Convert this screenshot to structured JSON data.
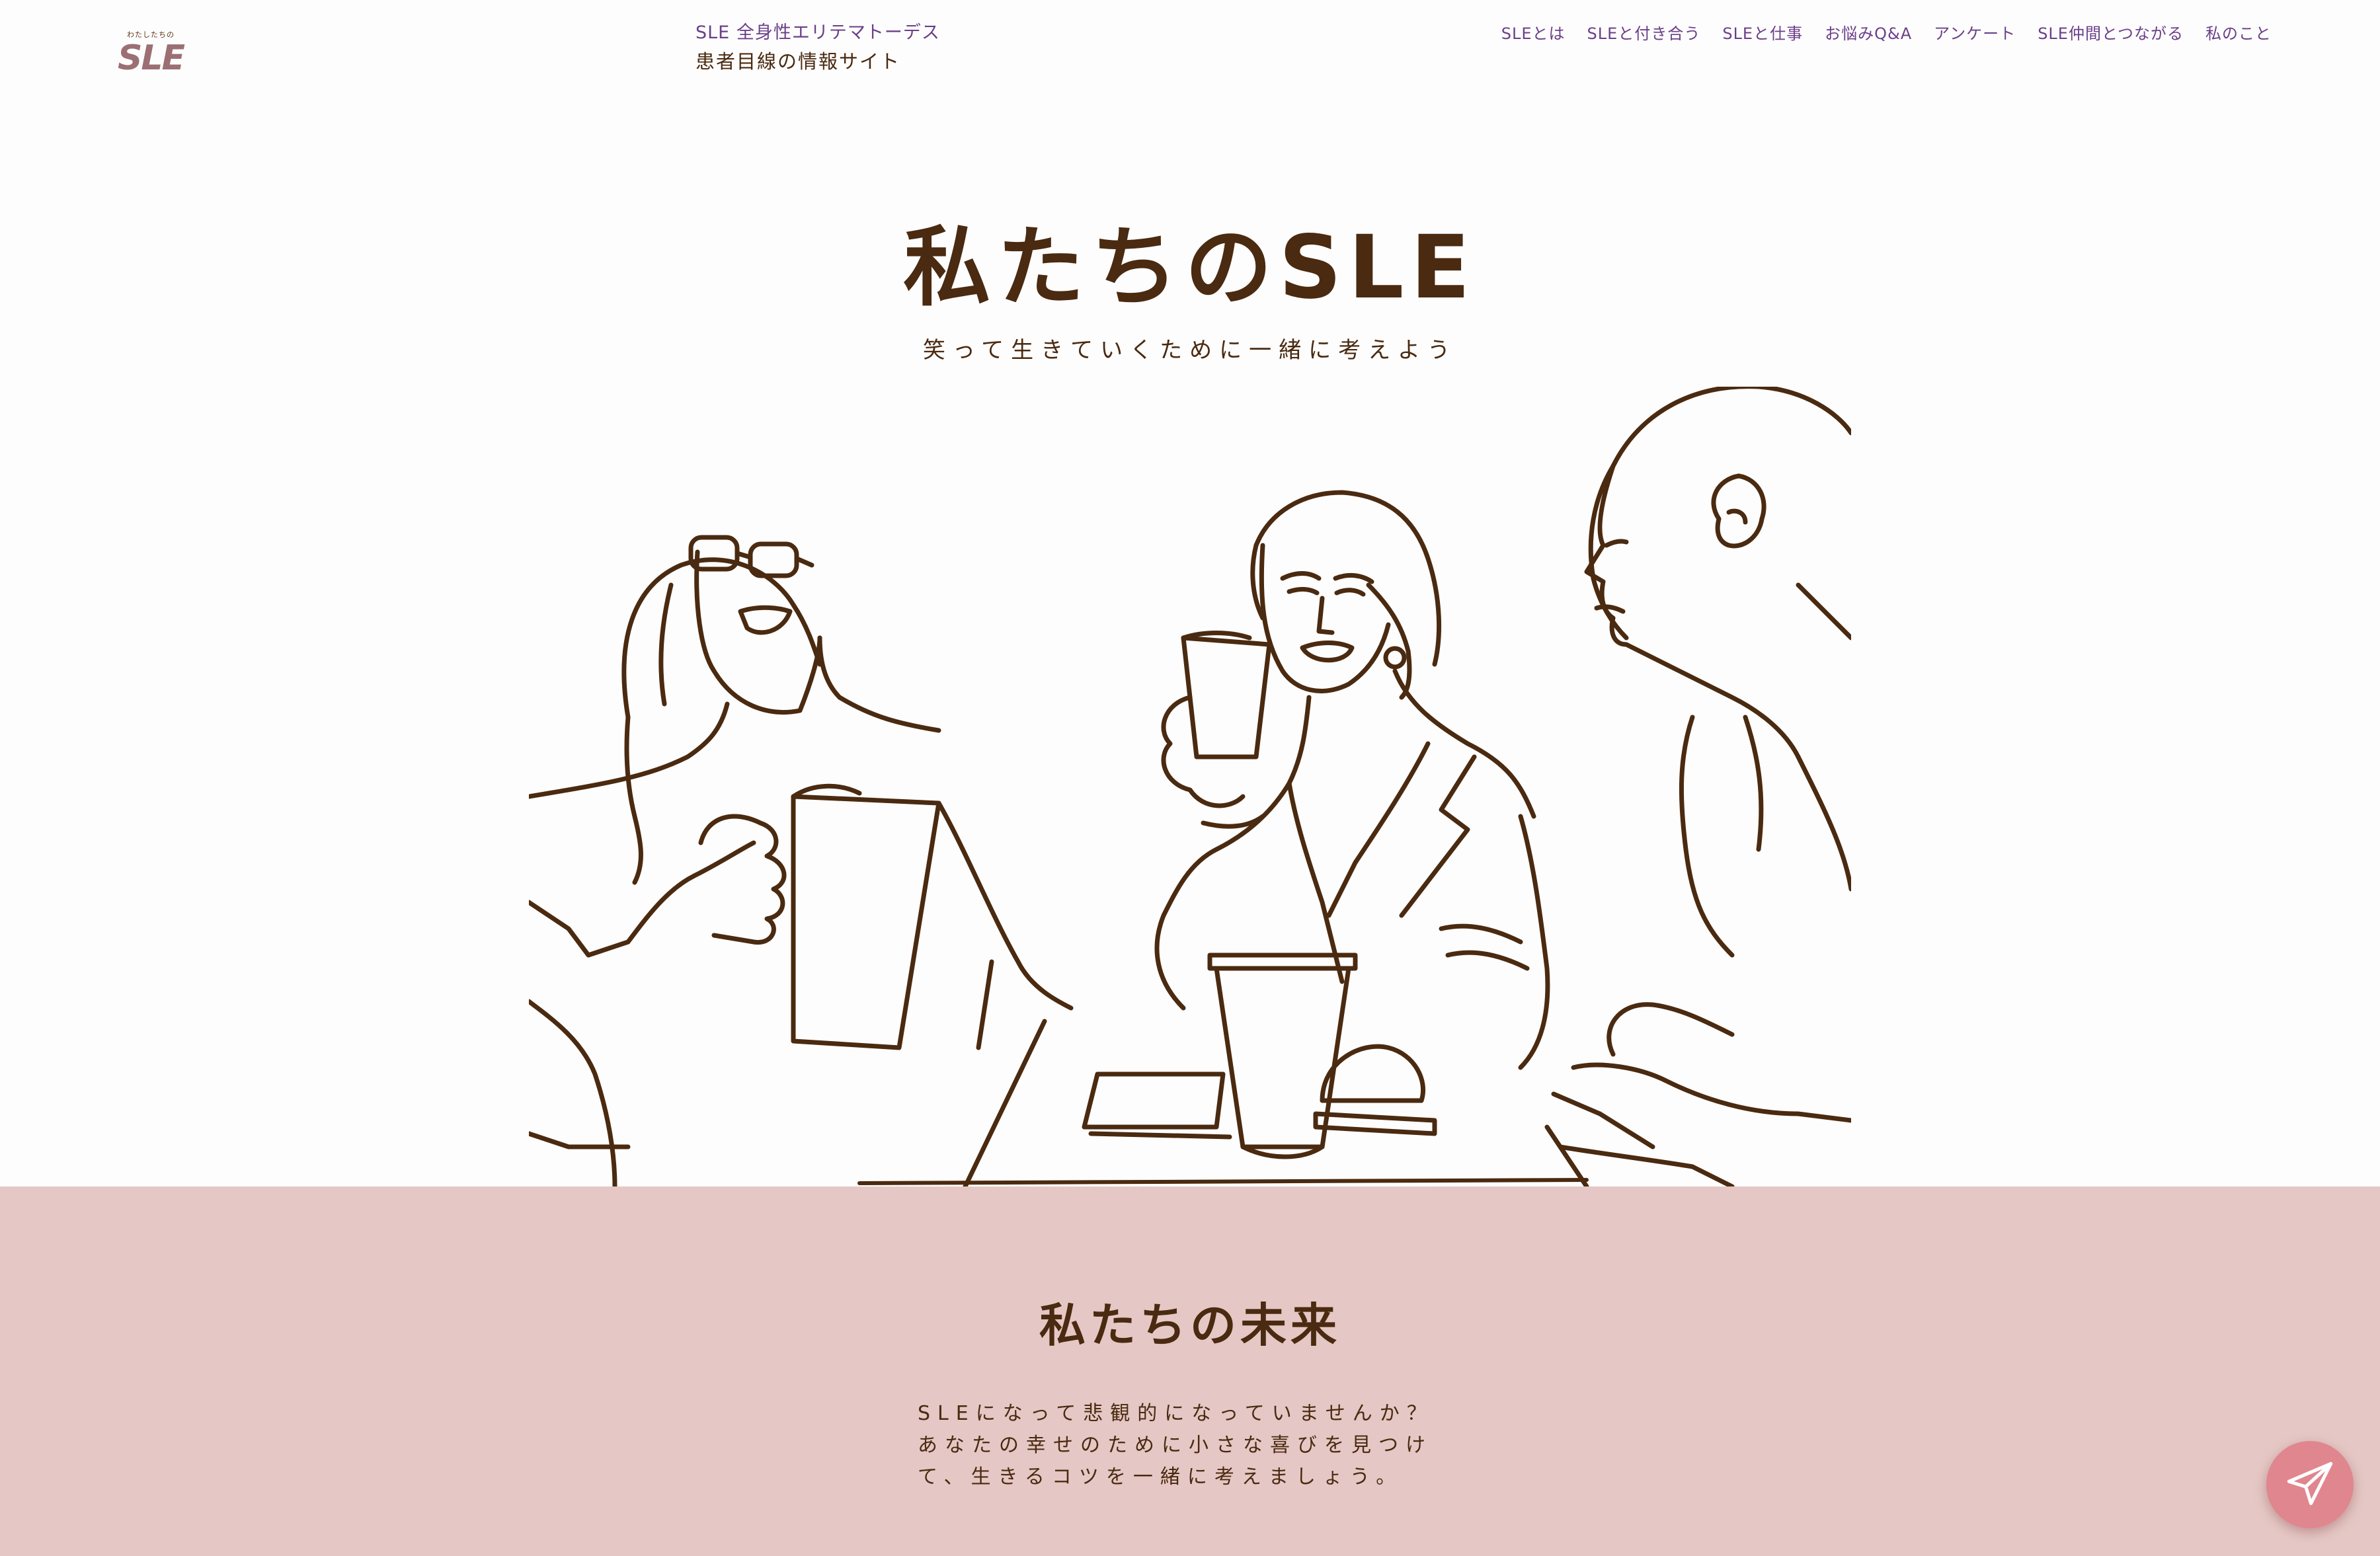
{
  "header": {
    "logo_small": "わたしたちの",
    "logo_main": "SLE",
    "site_title_line1": "SLE 全身性エリテマトーデス",
    "site_title_line2": "患者目線の情報サイト",
    "nav": [
      {
        "label": "SLEとは"
      },
      {
        "label": "SLEと付き合う"
      },
      {
        "label": "SLEと仕事"
      },
      {
        "label": "お悩みQ&A"
      },
      {
        "label": "アンケート"
      },
      {
        "label": "SLE仲間とつながる"
      },
      {
        "label": "私のこと"
      }
    ]
  },
  "hero": {
    "title": "私たちのSLE",
    "subtitle": "笑って生きていくために一緒に考えよう",
    "illustration": "line-drawing-three-women-chatting-with-coffee"
  },
  "future": {
    "title": "私たちの未来",
    "lines": [
      "SLEになって悲観的になっていませんか？",
      "あなたの幸せのために小さな喜びを見つけ",
      "て、生きるコツを一緒に考えましょう。"
    ]
  },
  "contact_button": {
    "icon": "paper-plane-icon"
  },
  "colors": {
    "brown": "#4a2a10",
    "purple": "#6a3f8a",
    "pink_section": "#e5c8c5",
    "contact_pink": "#e0868f",
    "logo": "#9b6f74"
  }
}
